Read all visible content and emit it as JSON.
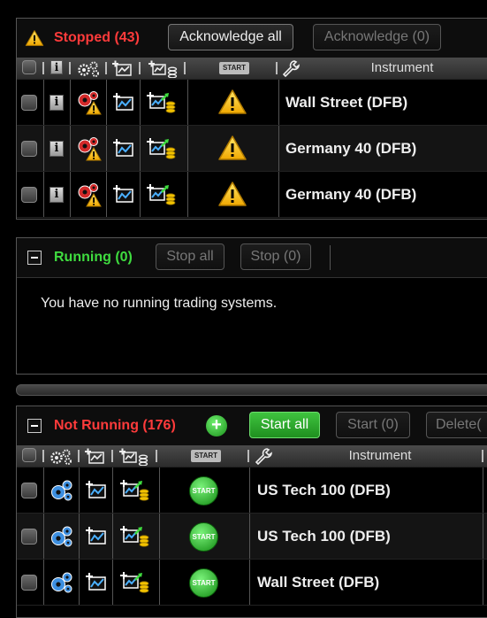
{
  "stopped": {
    "title": "Stopped (43)",
    "ack_all": "Acknowledge all",
    "ack_count": "Acknowledge (0)",
    "instrument_header": "Instrument",
    "rows": [
      {
        "instrument": "Wall Street (DFB)"
      },
      {
        "instrument": "Germany 40 (DFB)"
      },
      {
        "instrument": "Germany 40 (DFB)"
      }
    ]
  },
  "running": {
    "title": "Running (0)",
    "stop_all": "Stop all",
    "stop_count": "Stop (0)",
    "empty_message": "You have no running trading systems."
  },
  "not_running": {
    "title": "Not Running (176)",
    "start_all": "Start all",
    "start_count": "Start (0)",
    "delete_label": "Delete(",
    "instrument_header": "Instrument",
    "rows": [
      {
        "instrument": "US Tech 100 (DFB)"
      },
      {
        "instrument": "US Tech 100 (DFB)"
      },
      {
        "instrument": "Wall Street (DFB)"
      }
    ]
  },
  "labels": {
    "start_badge": "START",
    "start_small": "START"
  },
  "colors": {
    "stopped_title": "#ff3b3b",
    "running_title": "#3fdc3f",
    "not_running_title": "#ff3b3b",
    "warning": "#ffcc00",
    "start_green": "#22b622"
  }
}
